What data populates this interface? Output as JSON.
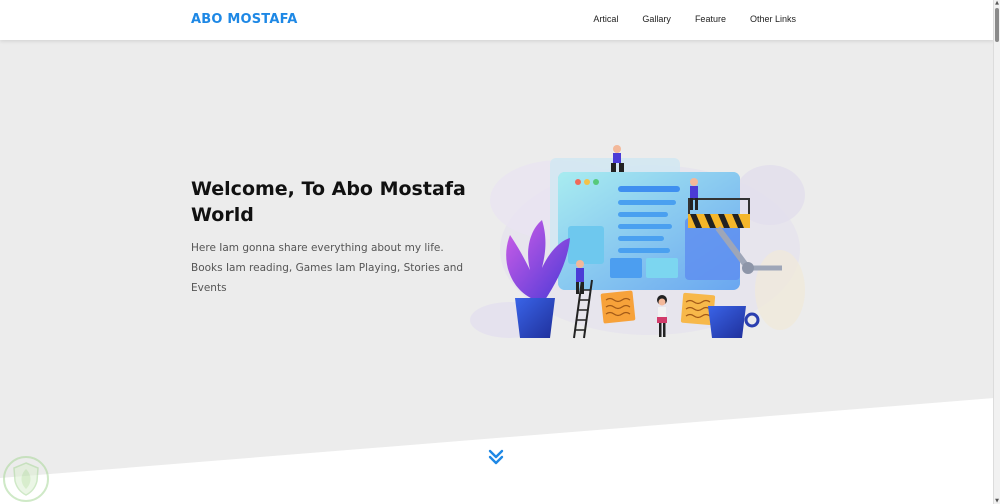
{
  "header": {
    "logo": "ABO MOSTAFA",
    "nav": [
      "Artical",
      "Gallary",
      "Feature",
      "Other Links"
    ]
  },
  "hero": {
    "title": "Welcome, To Abo Mostafa World",
    "text": "Here Iam gonna share everything about my life. Books Iam reading, Games Iam Playing, Stories and Events",
    "illustration_icon": "web-development-illustration",
    "scroll_icon": "double-chevron-down-icon"
  },
  "colors": {
    "accent": "#1e88e5",
    "hero_background": "#ececec",
    "title": "#111111",
    "body_text": "#555555"
  }
}
